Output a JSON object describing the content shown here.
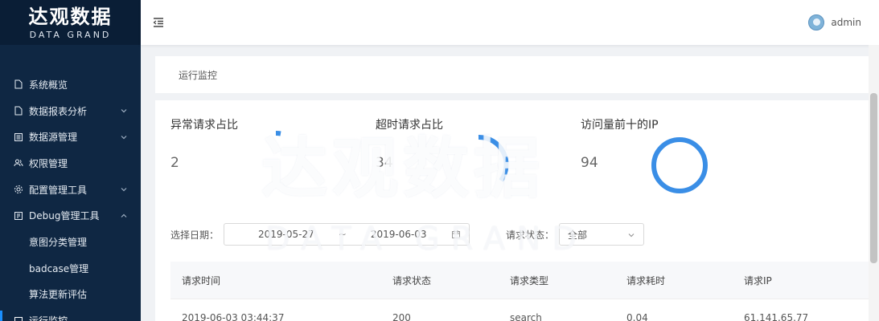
{
  "brand": {
    "name_cn": "达观数据",
    "name_en": "DATA GRAND"
  },
  "sidebar": {
    "items": [
      {
        "label": "系统概览",
        "icon": "file-icon"
      },
      {
        "label": "数据报表分析",
        "icon": "file-icon",
        "expandable": true
      },
      {
        "label": "数据源管理",
        "icon": "list-icon",
        "expandable": true
      },
      {
        "label": "权限管理",
        "icon": "users-icon"
      },
      {
        "label": "配置管理工具",
        "icon": "gear-icon",
        "expandable": true
      },
      {
        "label": "Debug管理工具",
        "icon": "debug-icon",
        "expanded": true
      }
    ],
    "subitems": [
      {
        "label": "意图分类管理"
      },
      {
        "label": "badcase管理"
      },
      {
        "label": "算法更新评估"
      },
      {
        "label": "运行监控",
        "active": true
      }
    ]
  },
  "header": {
    "user_name": "admin"
  },
  "breadcrumb": "运行监控",
  "stats": [
    {
      "title": "异常请求占比",
      "value": "2"
    },
    {
      "title": "超时请求占比",
      "value": "34"
    },
    {
      "title": "访问量前十的IP",
      "value": "94"
    }
  ],
  "filter": {
    "date_label": "选择日期：",
    "start_date": "2019-05-27",
    "separator": "~",
    "end_date": "2019-06-03",
    "status_label": "请求状态：",
    "status_value": "全部"
  },
  "table": {
    "headers": [
      "请求时间",
      "请求状态",
      "请求类型",
      "请求耗时",
      "请求IP"
    ],
    "rows": [
      [
        "2019-06-03 03:44:37",
        "200",
        "search",
        "0.04",
        "61.141.65.77"
      ]
    ]
  },
  "watermark": {
    "text_cn": "达观数据",
    "text_en": "DATA GRAND"
  },
  "colors": {
    "sidebar_bg": "#0f2743",
    "accent": "#1a8fff",
    "ring": "#3a8ee6"
  }
}
